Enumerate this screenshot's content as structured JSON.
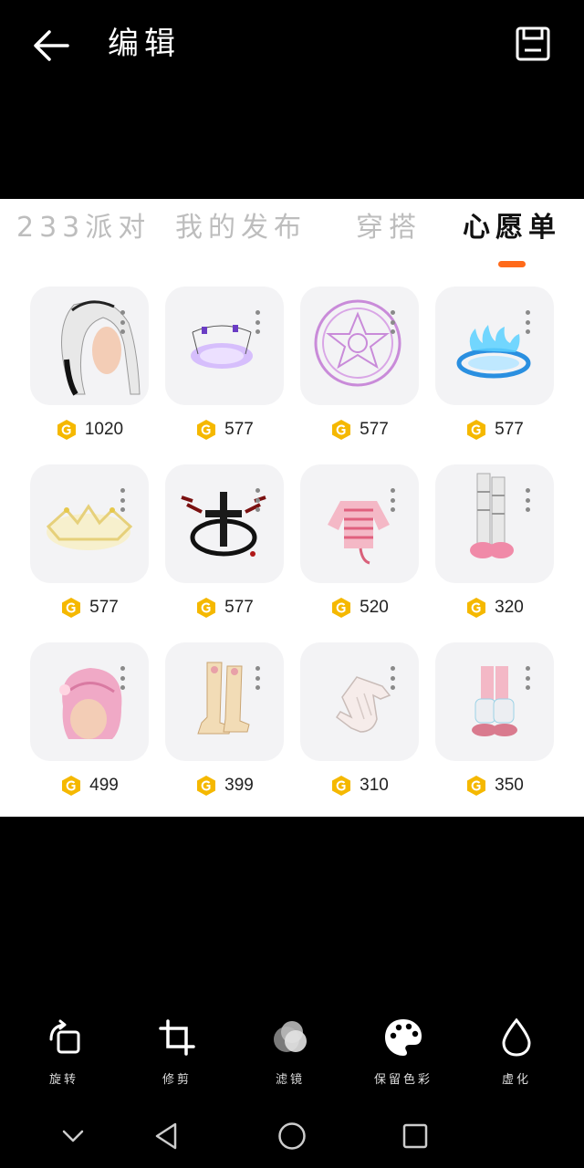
{
  "header": {
    "title": "编辑",
    "back_icon": "arrow-left-icon",
    "save_icon": "save-icon"
  },
  "tabs": [
    {
      "label": "233派对",
      "active": false
    },
    {
      "label": "我的发布",
      "active": false
    },
    {
      "label": "穿搭",
      "active": false
    },
    {
      "label": "心愿单",
      "active": true
    }
  ],
  "accent_color": "#ff6a1a",
  "coin_color": "#f5b800",
  "items": [
    {
      "name": "white-hair",
      "price": "1020"
    },
    {
      "name": "purple-glow-halo",
      "price": "577"
    },
    {
      "name": "magic-circle",
      "price": "577"
    },
    {
      "name": "blue-flame-ring",
      "price": "577"
    },
    {
      "name": "golden-crown-ring",
      "price": "577"
    },
    {
      "name": "dark-cross-circle",
      "price": "577"
    },
    {
      "name": "pink-striped-sweater",
      "price": "520"
    },
    {
      "name": "white-stockings-pink-shoes",
      "price": "320"
    },
    {
      "name": "pink-bob-hair",
      "price": "499"
    },
    {
      "name": "cream-boots",
      "price": "399"
    },
    {
      "name": "white-glove",
      "price": "310"
    },
    {
      "name": "pink-leg-warmers",
      "price": "350"
    }
  ],
  "tools": [
    {
      "label": "旋转",
      "icon": "rotate-icon"
    },
    {
      "label": "修剪",
      "icon": "crop-icon"
    },
    {
      "label": "滤镜",
      "icon": "filter-icon"
    },
    {
      "label": "保留色彩",
      "icon": "palette-icon"
    },
    {
      "label": "虚化",
      "icon": "blur-drop-icon"
    }
  ],
  "nav": {
    "collapse_icon": "chevron-down-icon",
    "back_icon": "nav-back-icon",
    "home_icon": "nav-home-icon",
    "recents_icon": "nav-recents-icon"
  }
}
